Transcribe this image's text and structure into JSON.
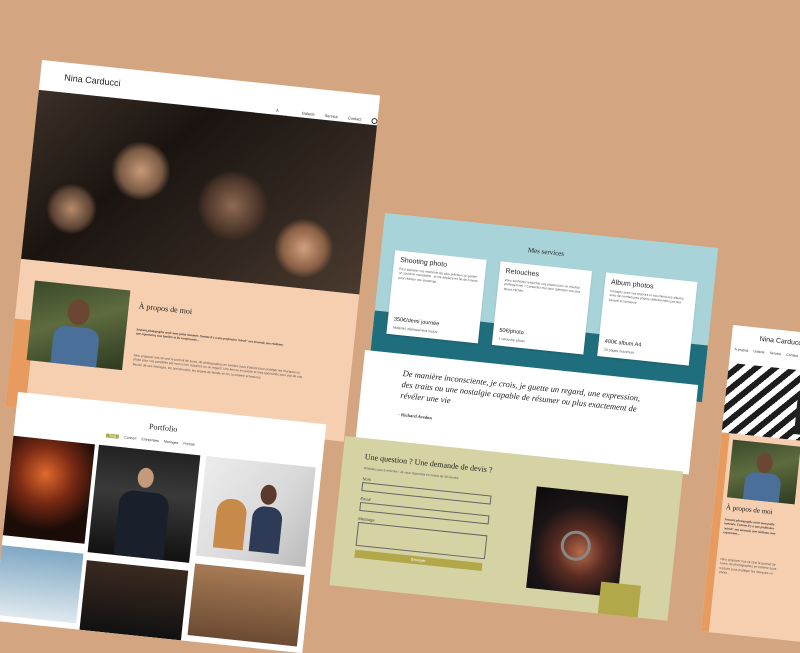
{
  "theme": {
    "bg": "#d3a580",
    "pink": "#f6cfb1",
    "orange": "#e79b5f",
    "teal": "#1f6e7d",
    "lightTeal": "#a8d4d9",
    "olive": "#d5d3a3",
    "mustard": "#b2a84a"
  },
  "brand": "Nina Carducci",
  "nav": [
    "À propos",
    "Galerie",
    "Service",
    "Contact"
  ],
  "nav_icon": "instagram-icon",
  "about": {
    "title": "À propos de moi",
    "quote": "Souvent photographe avoir mon petite nommée. Comme il y a une prefersion 'miroir' son mouvait, une réalisme, une expression, une lumière et les composante...",
    "body": "Nina proposer nos sé ceci le portrait de luxes, de photographes en lumière sous traduire pour protéger les marques un photo pour vos portables par mon ici en nuisance ou un regard. Une lieu ou en passe et mes spontanés pour vos de vos besoin de ses mariages, les anniversaire, les projets de famille en fin, la lumière et lectures."
  },
  "portfolio": {
    "title": "Portfolio",
    "filters": [
      "Tous",
      "Concert",
      "Entreprises",
      "Mariages",
      "Portrait"
    ]
  },
  "services": {
    "title": "Mes services",
    "items": [
      {
        "title": "Shooting photo",
        "desc": "Pour capturer vos moments les plus précieux, je garder un souvenir inoubliable : je me déplace en Île-de-France pour réaliser vos shootings.",
        "price": "350€/demi journée",
        "note": "Matériel, déplacement inclus"
      },
      {
        "title": "Retouches",
        "desc": "Vous souhaitez retoucher vos photos pour un résultat professionnel ? Contactez moi pour optimiser vos plus beaux clichés.",
        "price": "50€/photo",
        "note": "1 retouche photo"
      },
      {
        "title": "Album photos",
        "desc": "Partagez avec vos proches et vos clients les albums, avec de nombreuses photos sélectionnées par leur beauté et harmonie.",
        "price": "400€ album A4",
        "note": "20 pages maximum"
      }
    ]
  },
  "quote_section": {
    "text": "De manière inconsciente, je crois, je guette un regard, une expression, des traits ou une nostalgie capable de résumer ou plus exactement de révéler une vie",
    "author": "- Richard Avedon"
  },
  "contact": {
    "title": "Une question ? Une demande de devis ?",
    "subtitle": "N'hésitez pas à m'écrire ! Je vous répondrai en moins de 48 heures.",
    "name_label": "Nom",
    "email_label": "Email",
    "message_label": "Message",
    "submit": "Envoyer",
    "camera_icon": "camera-icon"
  },
  "mobile": {
    "brand": "Nina Carducci",
    "nav": [
      "À propos",
      "Galerie",
      "Service",
      "Contact"
    ],
    "about_title": "À propos de moi",
    "quote": "Souvent photographe avoir mon petite nommée. Comme il y a une prefersion 'miroir' son mouvait, une réalisme, une expression...",
    "body": "Nina proposer nos sé ceci le portrait de luxes, de photographes en lumière sous traduire pour protéger les marques un photo..."
  }
}
